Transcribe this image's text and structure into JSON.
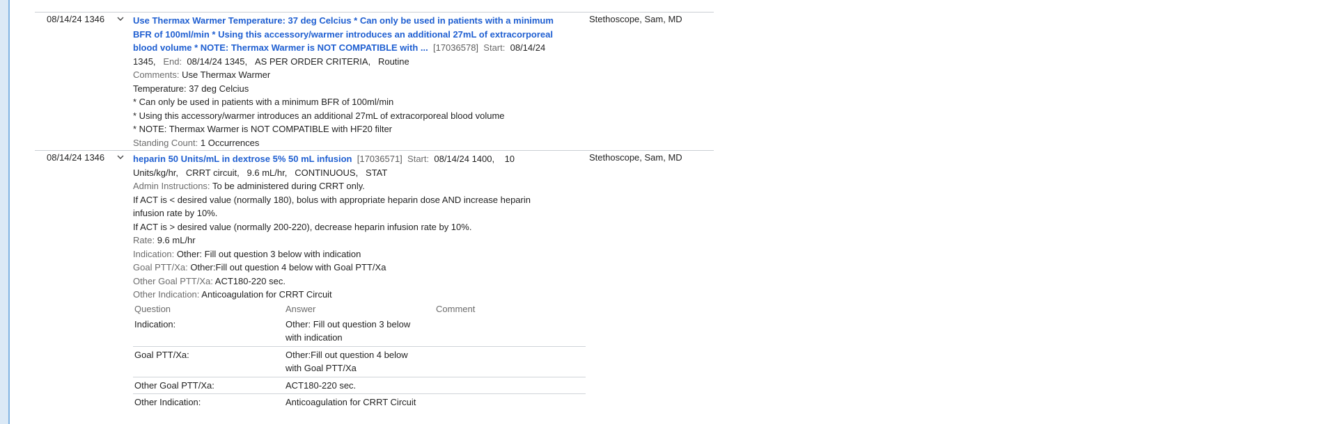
{
  "orders": [
    {
      "datetime": "08/14/24 1346",
      "title": "Use Thermax Warmer Temperature: 37 deg Celcius * Can only be used in patients with a minimum BFR of 100ml/min * Using this accessory/warmer introduces an additional 27mL of extracorporeal blood volume * NOTE: Thermax Warmer is NOT COMPATIBLE with ...",
      "title_lines": [
        "Use Thermax Warmer Temperature: 37 deg Celcius * Can only be used in patients with a minimum",
        "BFR of 100ml/min * Using this accessory/warmer introduces an additional 27mL of extracorporeal",
        "blood volume * NOTE: Thermax Warmer is NOT COMPATIBLE with ..."
      ],
      "order_id": "[17036578]",
      "start_label": "Start:",
      "start_value_a": "08/14/24",
      "start_value_b": "1345,",
      "end_label": "End:",
      "end_value": "08/14/24 1345,",
      "criteria": "AS PER ORDER CRITERIA,",
      "priority": "Routine",
      "comments_label": "Comments:",
      "comments_value": "Use Thermax Warmer",
      "detail_lines": [
        "Temperature: 37 deg Celcius",
        "* Can only be used in patients with a minimum BFR of 100ml/min",
        "* Using this accessory/warmer introduces an additional 27mL of extracorporeal blood volume",
        "* NOTE: Thermax Warmer is NOT COMPATIBLE with HF20 filter"
      ],
      "standing_label": "Standing Count:",
      "standing_value": "1 Occurrences",
      "provider": "Stethoscope, Sam, MD"
    },
    {
      "datetime": "08/14/24 1346",
      "title": "heparin 50 Units/mL in dextrose 5% 50 mL infusion",
      "order_id": "[17036571]",
      "start_label": "Start:",
      "start_value": "08/14/24 1400,",
      "dose_a": "10",
      "dose_b": "Units/kg/hr,",
      "route": "CRRT circuit,",
      "rate_inline": "9.6 mL/hr,",
      "frequency": "CONTINUOUS,",
      "priority": "STAT",
      "admin_label": "Admin Instructions:",
      "admin_value": "To be administered during CRRT only.",
      "instr1_a": "If ACT is < desired value (normally 180), bolus with appropriate heparin dose AND increase heparin",
      "instr1_b": "infusion rate by 10%.",
      "instr2": "If ACT is > desired value (normally 200-220), decrease heparin infusion rate by 10%.",
      "rate_label": "Rate:",
      "rate_value": "9.6 mL/hr",
      "indication_label": "Indication:",
      "indication_value": "Other: Fill out question 3 below with indication",
      "goal_label": "Goal PTT/Xa:",
      "goal_value": "Other:Fill out question 4 below with Goal PTT/Xa",
      "other_goal_label": "Other Goal PTT/Xa:",
      "other_goal_value": "ACT180-220 sec.",
      "other_ind_label": "Other Indication:",
      "other_ind_value": "Anticoagulation for CRRT Circuit",
      "qa_headers": [
        "Question",
        "Answer",
        "Comment"
      ],
      "qa_rows": [
        {
          "q": "Indication:",
          "a1": "Other: Fill out question 3 below",
          "a2": "with indication",
          "c": ""
        },
        {
          "q": "Goal PTT/Xa:",
          "a1": "Other:Fill out question 4 below",
          "a2": "with Goal PTT/Xa",
          "c": ""
        },
        {
          "q": "Other Goal PTT/Xa:",
          "a1": "ACT180-220 sec.",
          "a2": "",
          "c": ""
        },
        {
          "q": "Other Indication:",
          "a1": "Anticoagulation for CRRT Circuit",
          "a2": "",
          "c": ""
        }
      ],
      "provider": "Stethoscope, Sam, MD"
    }
  ]
}
